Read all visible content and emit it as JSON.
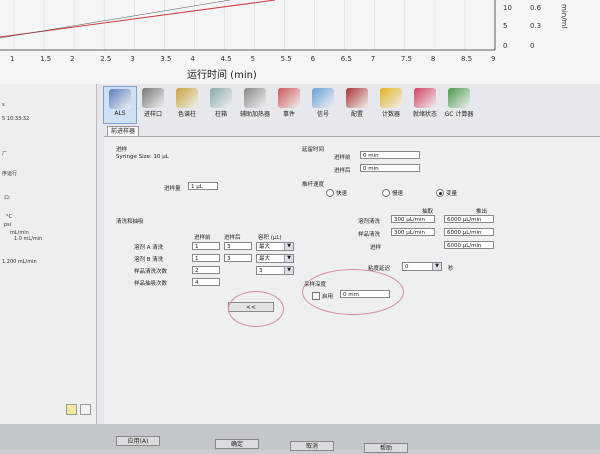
{
  "chart": {
    "x_ticks": [
      "1",
      "1.5",
      "2",
      "2.5",
      "3",
      "3.5",
      "4",
      "4.5",
      "5",
      "5.5",
      "6",
      "6.5",
      "7",
      "7.5",
      "8",
      "8.5",
      "9"
    ],
    "x_label": "运行时间 (min)",
    "y_left_ticks": [
      "10",
      "5",
      "0"
    ],
    "y_right_ticks": [
      "0.6",
      "0.3",
      "0"
    ],
    "y_unit": "min/ml",
    "line_color": "#d33a3a"
  },
  "left_panel": {
    "lines": [
      "s",
      "5 10:33:32",
      "ㄏ",
      "序运行",
      "°C",
      "psi",
      "mL/min",
      "ロ:",
      "1.0 mL/min",
      "1.200 mL/min"
    ]
  },
  "toolbar": {
    "items": [
      {
        "label": "ALS",
        "icon": "syringe-icon"
      },
      {
        "label": "进样口",
        "icon": "inlet-icon"
      },
      {
        "label": "色谱柱",
        "icon": "column-icon"
      },
      {
        "label": "柱箱",
        "icon": "oven-icon"
      },
      {
        "label": "辅助加热器",
        "icon": "heater-icon"
      },
      {
        "label": "事件",
        "icon": "event-icon"
      },
      {
        "label": "信号",
        "icon": "signal-icon"
      },
      {
        "label": "配置",
        "icon": "config-icon"
      },
      {
        "label": "计数器",
        "icon": "counter-icon"
      },
      {
        "label": "就绪状态",
        "icon": "ready-status-icon"
      },
      {
        "label": "GC 计算器",
        "icon": "calculator-icon"
      }
    ]
  },
  "tab_label": "前进样器",
  "injection": {
    "title": "进样",
    "syringe_size": "Syringe Size: 10 μL",
    "volume_label": "进样量",
    "volume_value": "1 μL"
  },
  "delay": {
    "title": "延留时间",
    "before_label": "进样前",
    "before_value": "0 min",
    "after_label": "进样后",
    "after_value": "0 min"
  },
  "speed": {
    "title": "推杆速度",
    "options": [
      "快速",
      "慢速",
      "变量"
    ],
    "selected": 2
  },
  "draw_eject": {
    "draw_header": "抽取",
    "eject_header": "推出",
    "rows": [
      {
        "label": "溶剂清洗",
        "draw": "300 μL/min",
        "eject": "6000 μL/min"
      },
      {
        "label": "样品清洗",
        "draw": "300 μL/min",
        "eject": "6000 μL/min"
      },
      {
        "label": "进样",
        "draw": "",
        "eject": "6000 μL/min"
      }
    ]
  },
  "viscosity": {
    "label": "粘度延迟",
    "value": "0",
    "unit": "秒"
  },
  "wash": {
    "title": "清洗和抽吸",
    "headers": [
      "进样前",
      "进样后",
      "容积 (μL)"
    ],
    "rows": [
      {
        "label": "溶剂 A 清洗",
        "before": "1",
        "after": "3",
        "volume": "最大"
      },
      {
        "label": "溶剂 B 清洗",
        "before": "1",
        "after": "3",
        "volume": "最大"
      },
      {
        "label": "样品清洗次数",
        "before": "2",
        "after": "",
        "volume": "3"
      },
      {
        "label": "样品抽吸次数",
        "before": "4",
        "after": "",
        "volume": ""
      }
    ]
  },
  "collapse_button": "<<",
  "depth": {
    "title": "采样深度",
    "enable_label": "启用",
    "value": "0 mm"
  },
  "footer": {
    "apply": "应用(A)",
    "ok": "确定",
    "cancel": "取消",
    "help": "帮助"
  }
}
